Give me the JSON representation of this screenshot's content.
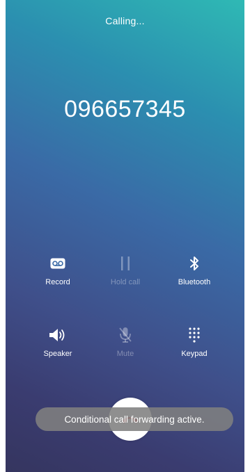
{
  "call": {
    "status": "Calling...",
    "number": "096657345"
  },
  "controls": [
    {
      "label": "Record",
      "icon": "voicemail-record-icon",
      "enabled": true
    },
    {
      "label": "Hold call",
      "icon": "pause-icon",
      "enabled": false
    },
    {
      "label": "Bluetooth",
      "icon": "bluetooth-icon",
      "enabled": true
    },
    {
      "label": "Speaker",
      "icon": "speaker-icon",
      "enabled": true
    },
    {
      "label": "Mute",
      "icon": "mic-off-icon",
      "enabled": false
    },
    {
      "label": "Keypad",
      "icon": "dialpad-icon",
      "enabled": true
    }
  ],
  "end_call": {
    "icon": "end-call-icon",
    "color": "#e53935"
  },
  "toast": {
    "message": "Conditional call forwarding active."
  },
  "colors": {
    "gradient_top": "#2fb9b4",
    "gradient_bottom": "#35355f",
    "text": "#ffffff"
  }
}
